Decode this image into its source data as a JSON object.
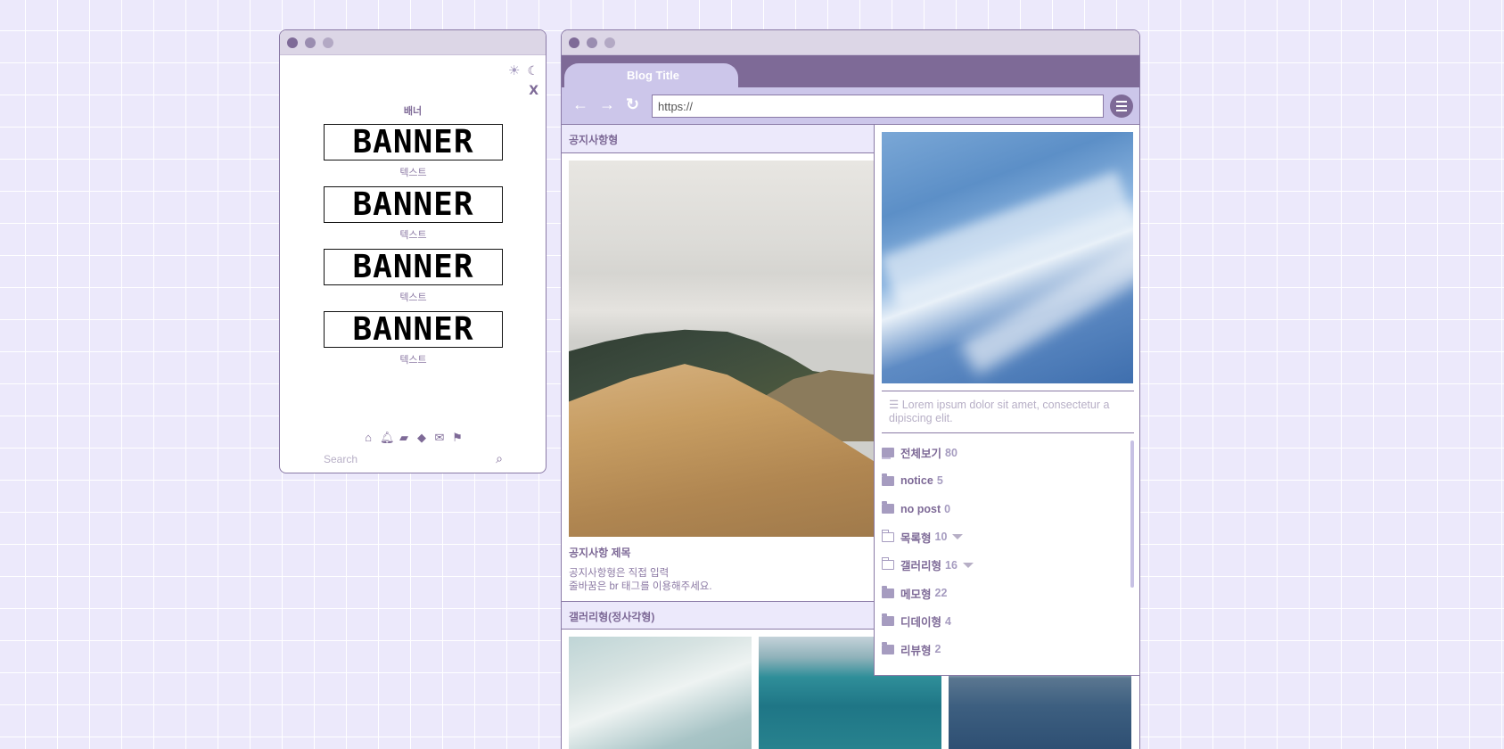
{
  "sidebar": {
    "banner_heading": "배너",
    "banners": [
      {
        "art": "BANNER",
        "caption": "텍스트"
      },
      {
        "art": "BANNER",
        "caption": "텍스트"
      },
      {
        "art": "BANNER",
        "caption": "텍스트"
      },
      {
        "art": "BANNER",
        "caption": "텍스트"
      }
    ],
    "close_label": "X",
    "icons": [
      "home-icon",
      "bell-icon",
      "folder-icon",
      "tag-icon",
      "mail-icon",
      "flag-icon"
    ],
    "search_placeholder": "Search"
  },
  "browser": {
    "tab_title": "Blog Title",
    "url": "https://",
    "colors": {
      "accent": "#7e6a97",
      "tab": "#ccc6ea",
      "background": "#ece9fb"
    }
  },
  "main": {
    "notice_section": "공지사항형",
    "notice_title": "공지사항 제목",
    "notice_line1": "공지사항형은 직접 입력",
    "notice_line2": "줄바꿈은 br 태그를 이용해주세요.",
    "gallery_section": "갤러리형(정사각형)"
  },
  "profile": {
    "description": "Lorem ipsum dolor sit amet, consectetur a dipiscing elit."
  },
  "categories": [
    {
      "name": "전체보기",
      "count": "80",
      "icon": "all"
    },
    {
      "name": "notice",
      "count": "5",
      "icon": "filled"
    },
    {
      "name": "no post",
      "count": "0",
      "icon": "filled"
    },
    {
      "name": "목록형",
      "count": "10",
      "icon": "open",
      "expandable": true
    },
    {
      "name": "갤러리형",
      "count": "16",
      "icon": "open",
      "expandable": true
    },
    {
      "name": "메모형",
      "count": "22",
      "icon": "filled"
    },
    {
      "name": "디데이형",
      "count": "4",
      "icon": "filled"
    },
    {
      "name": "리뷰형",
      "count": "2",
      "icon": "filled"
    }
  ]
}
